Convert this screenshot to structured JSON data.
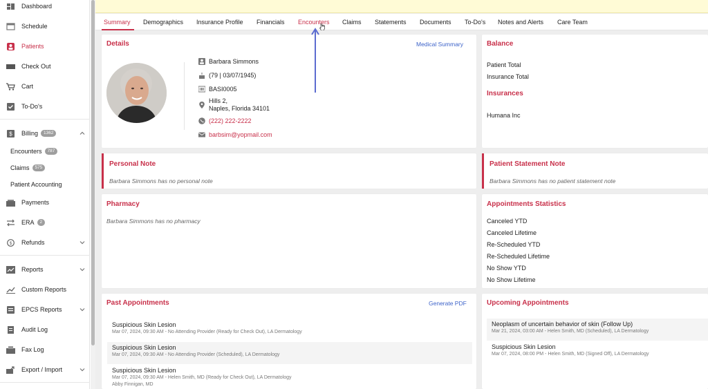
{
  "sidebar": {
    "items": [
      {
        "label": "Dashboard"
      },
      {
        "label": "Schedule"
      },
      {
        "label": "Patients"
      },
      {
        "label": "Check Out"
      },
      {
        "label": "Cart"
      },
      {
        "label": "To-Do's"
      },
      {
        "label": "Billing",
        "badge": "1362"
      },
      {
        "label": "Payments"
      },
      {
        "label": "ERA",
        "badge": "2"
      },
      {
        "label": "Refunds"
      },
      {
        "label": "Reports"
      },
      {
        "label": "Custom Reports"
      },
      {
        "label": "EPCS Reports"
      },
      {
        "label": "Audit Log"
      },
      {
        "label": "Fax Log"
      },
      {
        "label": "Export / Import"
      }
    ],
    "billing_sub": [
      {
        "label": "Encounters",
        "badge": "787"
      },
      {
        "label": "Claims",
        "badge": "575"
      },
      {
        "label": "Patient Accounting"
      }
    ]
  },
  "tabs": [
    "Summary",
    "Demographics",
    "Insurance Profile",
    "Financials",
    "Encounters",
    "Claims",
    "Statements",
    "Documents",
    "To-Do's",
    "Notes and Alerts",
    "Care Team"
  ],
  "details": {
    "title": "Details",
    "medical_summary_link": "Medical Summary",
    "name": "Barbara  Simmons",
    "age_dob": "(79 | 03/07/1945)",
    "chart_id": "BASI0005",
    "address_line1": "Hills 2,",
    "address_line2": "Naples, Florida 34101",
    "phone": "(222) 222-2222",
    "email": "barbsim@yopmail.com"
  },
  "balance": {
    "title": "Balance",
    "patient_total_label": "Patient Total",
    "insurance_total_label": "Insurance Total",
    "insurances_title": "Insurances",
    "insurance_name": "Humana Inc"
  },
  "personal_note": {
    "title": "Personal Note",
    "text": "Barbara Simmons has no personal note"
  },
  "statement_note": {
    "title": "Patient Statement Note",
    "text": "Barbara Simmons has no patient statement note"
  },
  "pharmacy": {
    "title": "Pharmacy",
    "text": "Barbara Simmons has no pharmacy"
  },
  "appt_stats": {
    "title": "Appointments Statistics",
    "rows": [
      "Canceled YTD",
      "Canceled Lifetime",
      "Re-Scheduled YTD",
      "Re-Scheduled Lifetime",
      "No Show YTD",
      "No Show Lifetime"
    ]
  },
  "past_appts": {
    "title": "Past Appointments",
    "generate_pdf": "Generate PDF",
    "items": [
      {
        "title": "Suspicious Skin Lesion",
        "detail": "Mar 07, 2024, 09:30 AM - No Attending Provider (Ready for Check Out), LA Dermatology",
        "extra": ""
      },
      {
        "title": "Suspicious Skin Lesion",
        "detail": "Mar 07, 2024, 09:30 AM - No Attending Provider (Scheduled), LA Dermatology",
        "extra": ""
      },
      {
        "title": "Suspicious Skin Lesion",
        "detail": "Mar 07, 2024, 09:30 AM - Helen Smith, MD (Ready for Check Out), LA Dermatology",
        "extra": "Abby Finnigan, MD"
      }
    ]
  },
  "upcoming_appts": {
    "title": "Upcoming Appointments",
    "items": [
      {
        "title": "Neoplasm of uncertain behavior of skin (Follow Up)",
        "detail": "Mar 21, 2024, 03:00 AM - Helen Smith, MD (Scheduled), LA Dermatology"
      },
      {
        "title": "Suspicious Skin Lesion",
        "detail": "Mar 07, 2024, 08:00 PM - Helen Smith, MD (Signed Off), LA Dermatology"
      }
    ]
  },
  "colors": {
    "accent": "#c8304a",
    "link": "#3d63c9",
    "annotation_arrow": "#5b6bd0"
  }
}
